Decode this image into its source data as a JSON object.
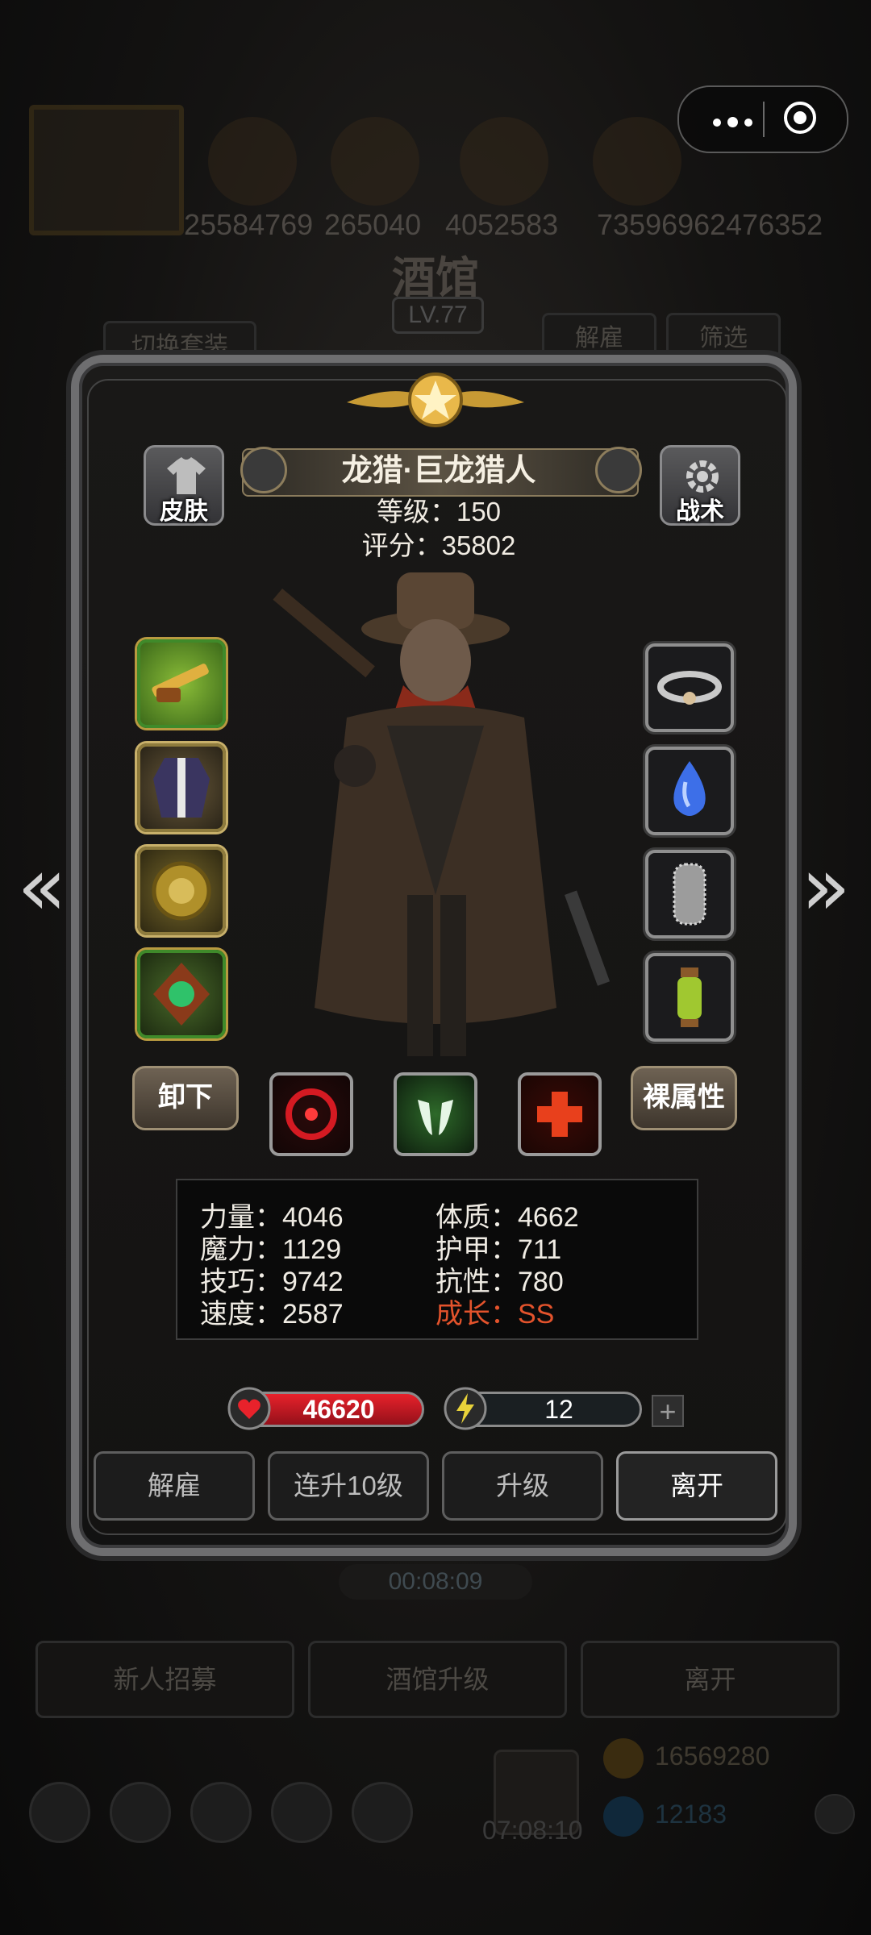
{
  "background": {
    "resources": [
      "25584769",
      "265040",
      "4052583",
      "7359696",
      "2476352"
    ],
    "title": "酒馆",
    "level": "LV.77",
    "switch_outfit": "切换套装",
    "dismiss": "解雇",
    "filter": "筛选",
    "timer": "00:08:09",
    "buttons": [
      "新人招募",
      "酒馆升级",
      "离开"
    ],
    "bottom_timer": "07:08:10",
    "gold": "16569280",
    "gems": "12183"
  },
  "hero": {
    "name": "龙猎·巨龙猎人",
    "level_label": "等级：150",
    "score_label": "评分：35802",
    "skin_label": "皮肤",
    "tactics_label": "战术",
    "unequip_label": "卸下",
    "naked_attr_label": "裸属性"
  },
  "attributes": {
    "strength": "力量：4046",
    "magic": "魔力：1129",
    "skill": "技巧：9742",
    "speed": "速度：2587",
    "constitution": "体质：4662",
    "armor": "护甲：711",
    "resistance": "抗性：780",
    "growth": "成长：SS"
  },
  "bars": {
    "hp": "46620",
    "energy": "12",
    "energy_fill": 0.1,
    "plus": "+"
  },
  "actions": {
    "dismiss": "解雇",
    "level_up_10": "连升10级",
    "level_up": "升级",
    "leave": "离开"
  },
  "colors": {
    "growth": "#e3532c",
    "hp": "#e8222b",
    "energy": "#e8e046"
  },
  "icons": {
    "left_slots": [
      "golden-shotgun-icon",
      "coat-armor-icon",
      "gold-medal-icon",
      "emerald-amulet-icon"
    ],
    "right_slots": [
      "cloud-ring-icon",
      "blue-drop-icon",
      "chainmail-icon",
      "lantern-icon"
    ],
    "skills": [
      "red-target-skill-icon",
      "green-claw-skill-icon",
      "red-cross-skill-icon"
    ]
  }
}
